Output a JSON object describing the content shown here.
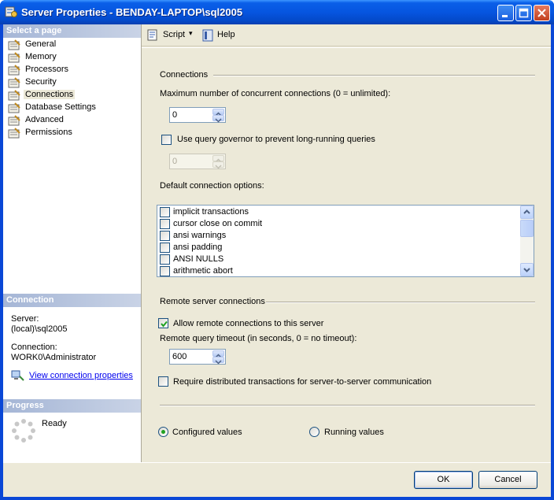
{
  "window": {
    "title": "Server Properties - BENDAY-LAPTOP\\sql2005",
    "controls": [
      "minimize",
      "maximize",
      "close"
    ]
  },
  "sidebar": {
    "header": "Select a page",
    "items": [
      {
        "label": "General",
        "icon": "page-icon"
      },
      {
        "label": "Memory",
        "icon": "page-icon"
      },
      {
        "label": "Processors",
        "icon": "page-icon"
      },
      {
        "label": "Security",
        "icon": "page-icon"
      },
      {
        "label": "Connections",
        "icon": "page-icon",
        "selected": true
      },
      {
        "label": "Database Settings",
        "icon": "page-icon"
      },
      {
        "label": "Advanced",
        "icon": "page-icon"
      },
      {
        "label": "Permissions",
        "icon": "page-icon"
      }
    ]
  },
  "connection": {
    "header": "Connection",
    "server_label": "Server:",
    "server_value": "(local)\\sql2005",
    "connection_label": "Connection:",
    "connection_value": "WORK0\\Administrator",
    "view_link": "View connection properties"
  },
  "progress": {
    "header": "Progress",
    "status": "Ready"
  },
  "toolbar": {
    "script_label": "Script",
    "help_label": "Help"
  },
  "connections_section": {
    "title": "Connections",
    "max_conn_label": "Maximum number of concurrent connections (0 = unlimited):",
    "max_conn_value": "0",
    "governor_label": "Use query governor to prevent long-running queries",
    "governor_checked": false,
    "governor_value": "0",
    "default_options_label": "Default connection options:",
    "options": [
      {
        "label": "implicit transactions",
        "checked": false
      },
      {
        "label": "cursor close on commit",
        "checked": false
      },
      {
        "label": "ansi warnings",
        "checked": false
      },
      {
        "label": "ansi padding",
        "checked": false
      },
      {
        "label": "ANSI NULLS",
        "checked": false
      },
      {
        "label": "arithmetic abort",
        "checked": false
      }
    ]
  },
  "remote_section": {
    "title": "Remote server connections",
    "allow_remote_label": "Allow remote connections to this server",
    "allow_remote_checked": true,
    "timeout_label": "Remote query timeout (in seconds, 0 = no timeout):",
    "timeout_value": "600",
    "distributed_label": "Require distributed transactions for server-to-server communication",
    "distributed_checked": false
  },
  "values_mode": {
    "configured_label": "Configured values",
    "running_label": "Running values",
    "selected": "configured"
  },
  "buttons": {
    "ok": "OK",
    "cancel": "Cancel"
  }
}
